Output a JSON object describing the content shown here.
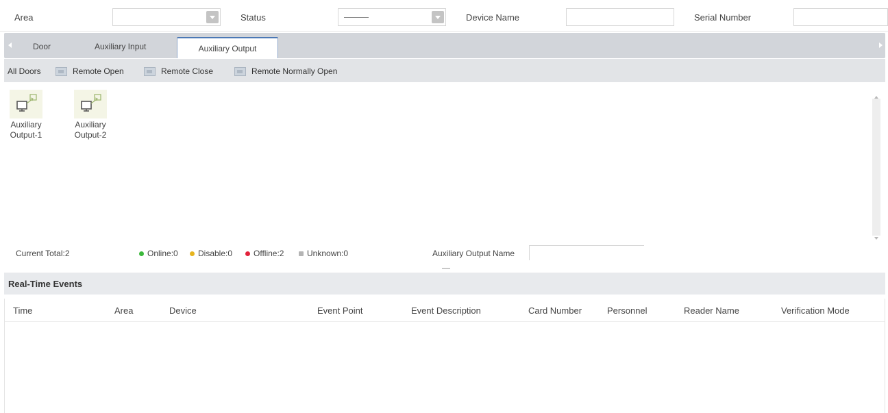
{
  "filters": {
    "area_label": "Area",
    "area_value": "",
    "status_label": "Status",
    "status_value": "———",
    "device_name_label": "Device Name",
    "device_name_value": "",
    "serial_number_label": "Serial Number",
    "serial_number_value": ""
  },
  "tabs": [
    {
      "label": "Door"
    },
    {
      "label": "Auxiliary Input"
    },
    {
      "label": "Auxiliary Output"
    }
  ],
  "active_tab": "Auxiliary Output",
  "actions": {
    "all_doors": "All Doors",
    "remote_open": "Remote Open",
    "remote_close": "Remote Close",
    "remote_normally_open": "Remote Normally Open"
  },
  "devices": [
    {
      "label_line1": "Auxiliary",
      "label_line2": "Output-1",
      "icon": "monitor-output-icon"
    },
    {
      "label_line1": "Auxiliary",
      "label_line2": "Output-2",
      "icon": "monitor-output-icon"
    }
  ],
  "status": {
    "current_total": "Current Total:2",
    "online": "Online:0",
    "disable": "Disable:0",
    "offline": "Offline:2",
    "unknown": "Unknown:0",
    "output_name_label": "Auxiliary Output Name",
    "output_name_value": "",
    "colors": {
      "online": "#3cb83c",
      "disable": "#e6b41e",
      "offline": "#e2223a",
      "unknown": "#b4b4b4"
    }
  },
  "realtime": {
    "title": "Real-Time Events",
    "columns": [
      "Time",
      "Area",
      "Device",
      "Event Point",
      "Event Description",
      "Card Number",
      "Personnel",
      "Reader Name",
      "Verification Mode"
    ],
    "rows": []
  },
  "colors": {
    "tab_strip": "#d2d5da",
    "action_bar": "#e2e4e7",
    "active_tab_border": "#4b78b5"
  }
}
